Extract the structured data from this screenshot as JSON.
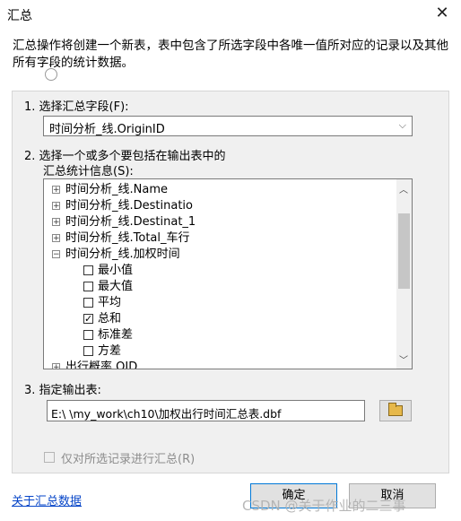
{
  "dialog": {
    "title": "汇总",
    "close_glyph": "✕",
    "description": "汇总操作将创建一个新表，表中包含了所选字段中各唯一值所对应的记录以及其他所有字段的统计数据。"
  },
  "step1": {
    "label": "1. 选择汇总字段(F):",
    "selected_value": "时间分析_线.OriginID",
    "arrow": "⌵"
  },
  "step2": {
    "label_line1": "2. 选择一个或多个要包括在输出表中的",
    "label_line2": "汇总统计信息(S):",
    "tree_items": [
      {
        "text": "时间分析_线.Name",
        "expander": "+"
      },
      {
        "text": "时间分析_线.Destinatio",
        "expander": "+"
      },
      {
        "text": "时间分析_线.Destinat_1",
        "expander": "+"
      },
      {
        "text": "时间分析_线.Total_车行",
        "expander": "+"
      },
      {
        "text": "时间分析_线.加权时间",
        "expander": "−"
      },
      {
        "text": "出行概率.OID",
        "expander": "+"
      }
    ],
    "stat_items": [
      {
        "text": "最小值",
        "checked": false
      },
      {
        "text": "最大值",
        "checked": false
      },
      {
        "text": "平均",
        "checked": false
      },
      {
        "text": "总和",
        "checked": true
      },
      {
        "text": "标准差",
        "checked": false
      },
      {
        "text": "方差",
        "checked": false
      }
    ],
    "scroll_up": "︿",
    "scroll_down": "﹀"
  },
  "step3": {
    "label": "3. 指定输出表:",
    "output_path": "E:\\         \\my_work\\ch10\\加权出行时间汇总表.dbf"
  },
  "selected_only": {
    "label": "仅对所选记录进行汇总(R)",
    "checked": false,
    "enabled": false
  },
  "footer": {
    "help_link": "关于汇总数据",
    "ok_label": "确定",
    "cancel_label": "取消"
  },
  "watermark": "CSDN @关于作业的二三事"
}
